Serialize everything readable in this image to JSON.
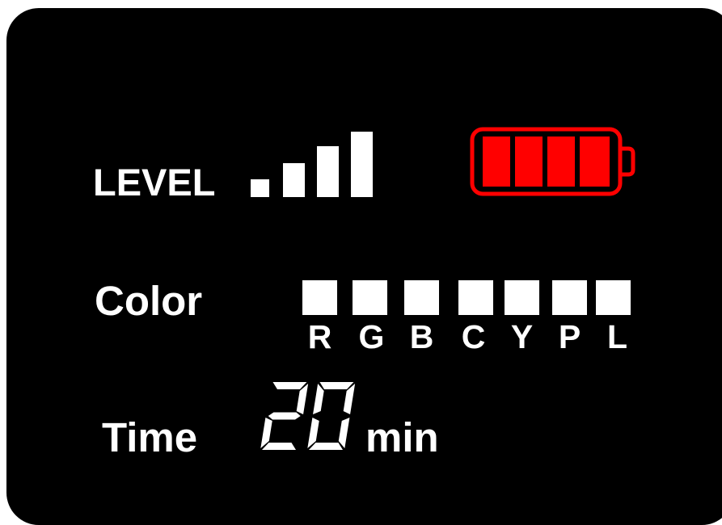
{
  "level": {
    "label": "LEVEL",
    "bars_total": 4,
    "bars_active": 4
  },
  "battery": {
    "icon": "battery-icon",
    "color": "#ff0000",
    "segments_total": 4,
    "segments_filled": 4
  },
  "color": {
    "label": "Color",
    "options": [
      "R",
      "G",
      "B",
      "C",
      "Y",
      "P",
      "L"
    ]
  },
  "time": {
    "label": "Time",
    "value": "20",
    "unit": "min"
  },
  "colors": {
    "background": "#000000",
    "foreground": "#ffffff",
    "battery": "#ff0000"
  }
}
